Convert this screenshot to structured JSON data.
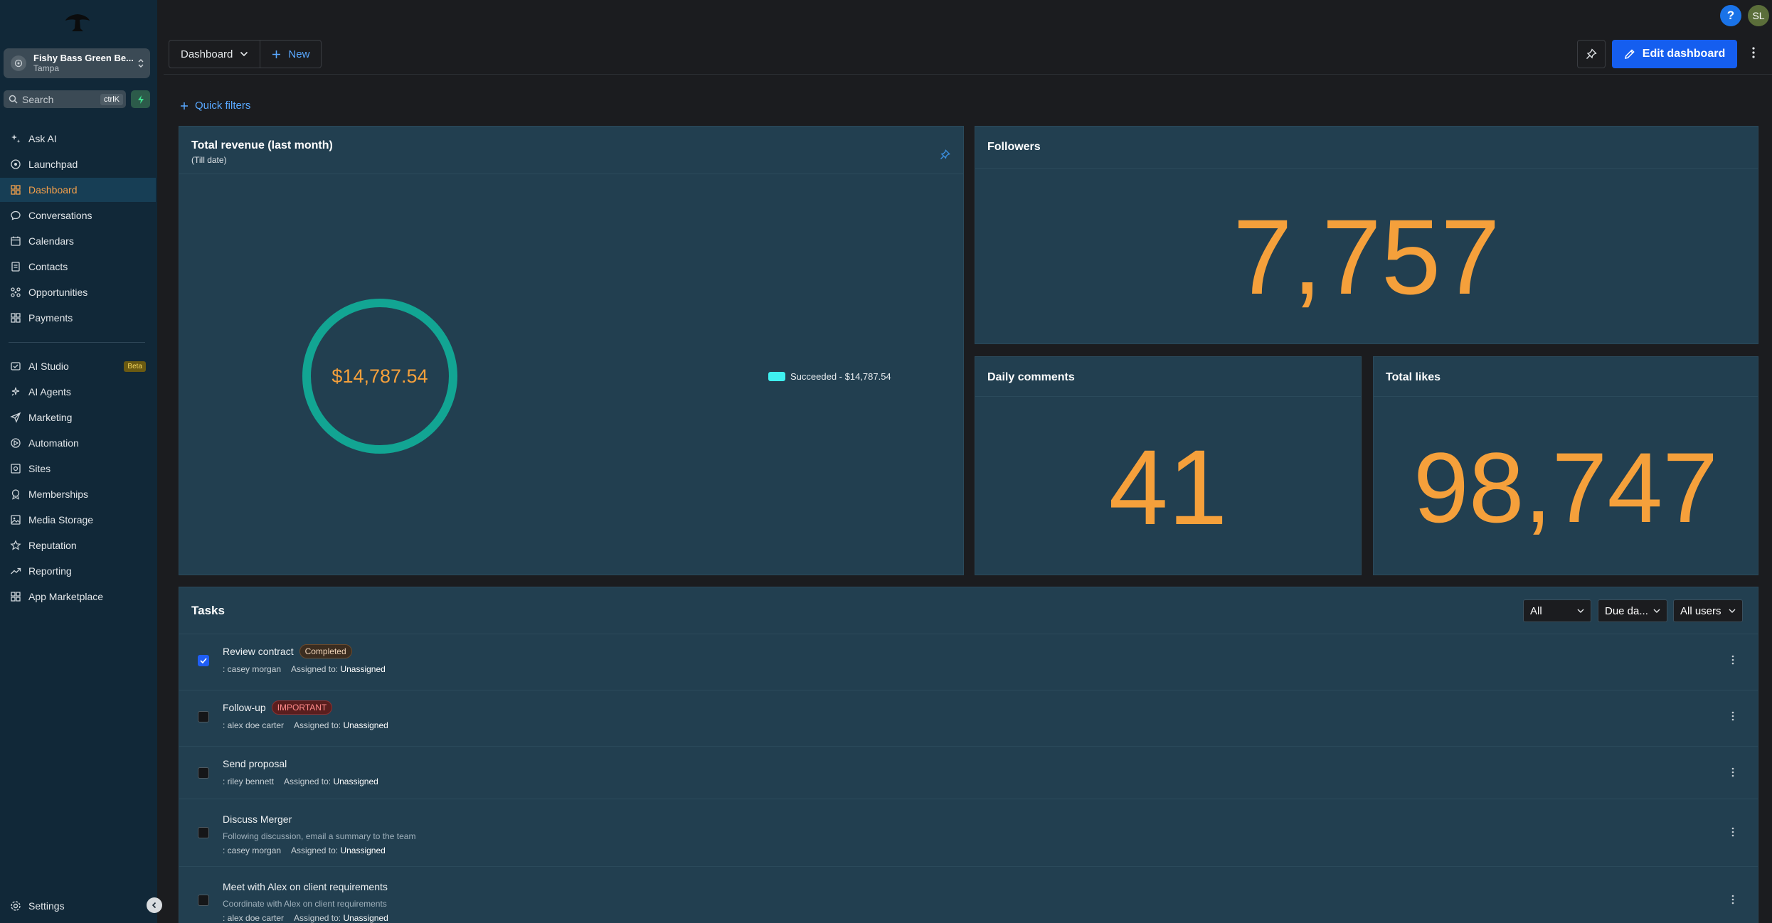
{
  "account": {
    "name": "Fishy Bass Green Be...",
    "location": "Tampa"
  },
  "search": {
    "placeholder": "Search",
    "shortcut": "ctrlK"
  },
  "nav": [
    {
      "label": "Ask AI",
      "icon": "sparkle-icon"
    },
    {
      "label": "Launchpad",
      "icon": "launchpad-icon"
    },
    {
      "label": "Dashboard",
      "icon": "dashboard-grid-icon",
      "active": true
    },
    {
      "label": "Conversations",
      "icon": "chat-icon"
    },
    {
      "label": "Calendars",
      "icon": "calendar-icon"
    },
    {
      "label": "Contacts",
      "icon": "contacts-icon"
    },
    {
      "label": "Opportunities",
      "icon": "opportunities-icon"
    },
    {
      "label": "Payments",
      "icon": "payments-icon"
    }
  ],
  "nav2": [
    {
      "label": "AI Studio",
      "icon": "ai-studio-icon",
      "badge": "Beta"
    },
    {
      "label": "AI Agents",
      "icon": "ai-agents-icon"
    },
    {
      "label": "Marketing",
      "icon": "send-icon"
    },
    {
      "label": "Automation",
      "icon": "automation-icon"
    },
    {
      "label": "Sites",
      "icon": "sites-icon"
    },
    {
      "label": "Memberships",
      "icon": "memberships-icon"
    },
    {
      "label": "Media Storage",
      "icon": "image-icon"
    },
    {
      "label": "Reputation",
      "icon": "star-icon"
    },
    {
      "label": "Reporting",
      "icon": "trend-icon"
    },
    {
      "label": "App Marketplace",
      "icon": "apps-grid-icon"
    }
  ],
  "settings_label": "Settings",
  "topbar": {
    "help": "?",
    "avatar_initials": "SL"
  },
  "toolbar": {
    "dashboard_label": "Dashboard",
    "new_label": "New",
    "edit_label": "Edit dashboard"
  },
  "quick_filters": "Quick filters",
  "revenue": {
    "title": "Total revenue (last month)",
    "subtitle": "(Till date)",
    "total": "$14,787.54",
    "legend": "Succeeded - $14,787.54",
    "ring_color": "#12a593",
    "legend_color": "#3ff0f0"
  },
  "followers": {
    "title": "Followers",
    "value": "7,757"
  },
  "comments": {
    "title": "Daily comments",
    "value": "41"
  },
  "likes": {
    "title": "Total likes",
    "value": "98,747"
  },
  "tasks": {
    "title": "Tasks",
    "filters": {
      "status": "All",
      "sort": "Due da...",
      "users": "All users"
    },
    "items": [
      {
        "name": "Review contract",
        "badge": "Completed",
        "badge_type": "completed",
        "checked": true,
        "description": "",
        "contact": ": casey morgan",
        "assigned_prefix": "Assigned to:",
        "assigned": "Unassigned"
      },
      {
        "name": "Follow-up",
        "badge": "IMPORTANT",
        "badge_type": "important",
        "checked": false,
        "description": "",
        "contact": ": alex doe carter",
        "assigned_prefix": "Assigned to:",
        "assigned": "Unassigned"
      },
      {
        "name": "Send proposal",
        "badge": "",
        "badge_type": "",
        "checked": false,
        "description": "",
        "contact": ": riley bennett",
        "assigned_prefix": "Assigned to:",
        "assigned": "Unassigned"
      },
      {
        "name": "Discuss Merger",
        "badge": "",
        "badge_type": "",
        "checked": false,
        "description": "Following discussion, email a summary to the team",
        "contact": ": casey morgan",
        "assigned_prefix": "Assigned to:",
        "assigned": "Unassigned"
      },
      {
        "name": "Meet with Alex on client requirements",
        "badge": "",
        "badge_type": "",
        "checked": false,
        "description": "Coordinate with Alex on client requirements",
        "contact": ": alex doe carter",
        "assigned_prefix": "Assigned to:",
        "assigned": "Unassigned"
      }
    ]
  }
}
